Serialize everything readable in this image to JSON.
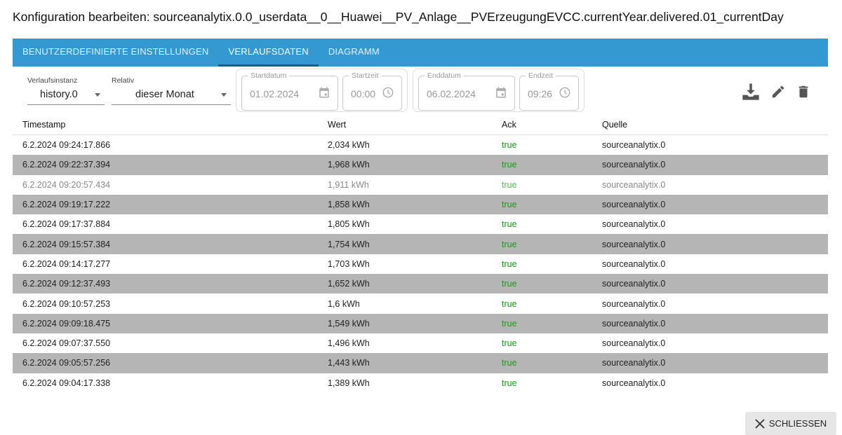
{
  "title": "Konfiguration bearbeiten: sourceanalytix.0.0_userdata__0__Huawei__PV_Anlage__PVErzeugungEVCC.currentYear.delivered.01_currentDay",
  "tabs": [
    "BENUTZERDEFINIERTE EINSTELLUNGEN",
    "VERLAUFSDATEN",
    "DIAGRAMM"
  ],
  "filters": {
    "instance_label": "Verlaufsinstanz",
    "instance_value": "history.0",
    "relative_label": "Relativ",
    "relative_value": "dieser Monat",
    "start_date_label": "Startdatum",
    "start_date": "01.02.2024",
    "start_time_label": "Startzeit",
    "start_time": "00:00",
    "end_date_label": "Enddatum",
    "end_date": "06.02.2024",
    "end_time_label": "Endzeit",
    "end_time": "09:26"
  },
  "table": {
    "headers": [
      "Timestamp",
      "Wert",
      "Ack",
      "Quelle"
    ],
    "rows": [
      [
        "6.2.2024 09:24:17.866",
        "2,034 kWh",
        "true",
        "sourceanalytix.0"
      ],
      [
        "6.2.2024 09:22:37.394",
        "1,968 kWh",
        "true",
        "sourceanalytix.0"
      ],
      [
        "6.2.2024 09:20:57.434",
        "1,911 kWh",
        "true",
        "sourceanalytix.0"
      ],
      [
        "6.2.2024 09:19:17.222",
        "1,858 kWh",
        "true",
        "sourceanalytix.0"
      ],
      [
        "6.2.2024 09:17:37.884",
        "1,805 kWh",
        "true",
        "sourceanalytix.0"
      ],
      [
        "6.2.2024 09:15:57.384",
        "1,754 kWh",
        "true",
        "sourceanalytix.0"
      ],
      [
        "6.2.2024 09:14:17.277",
        "1,703 kWh",
        "true",
        "sourceanalytix.0"
      ],
      [
        "6.2.2024 09:12:37.493",
        "1,652 kWh",
        "true",
        "sourceanalytix.0"
      ],
      [
        "6.2.2024 09:10:57.253",
        "1,6 kWh",
        "true",
        "sourceanalytix.0"
      ],
      [
        "6.2.2024 09:09:18.475",
        "1,549 kWh",
        "true",
        "sourceanalytix.0"
      ],
      [
        "6.2.2024 09:07:37.550",
        "1,496 kWh",
        "true",
        "sourceanalytix.0"
      ],
      [
        "6.2.2024 09:05:57.256",
        "1,443 kWh",
        "true",
        "sourceanalytix.0"
      ],
      [
        "6.2.2024 09:04:17.338",
        "1,389 kWh",
        "true",
        "sourceanalytix.0"
      ]
    ]
  },
  "close_label": "SCHLIESSEN"
}
